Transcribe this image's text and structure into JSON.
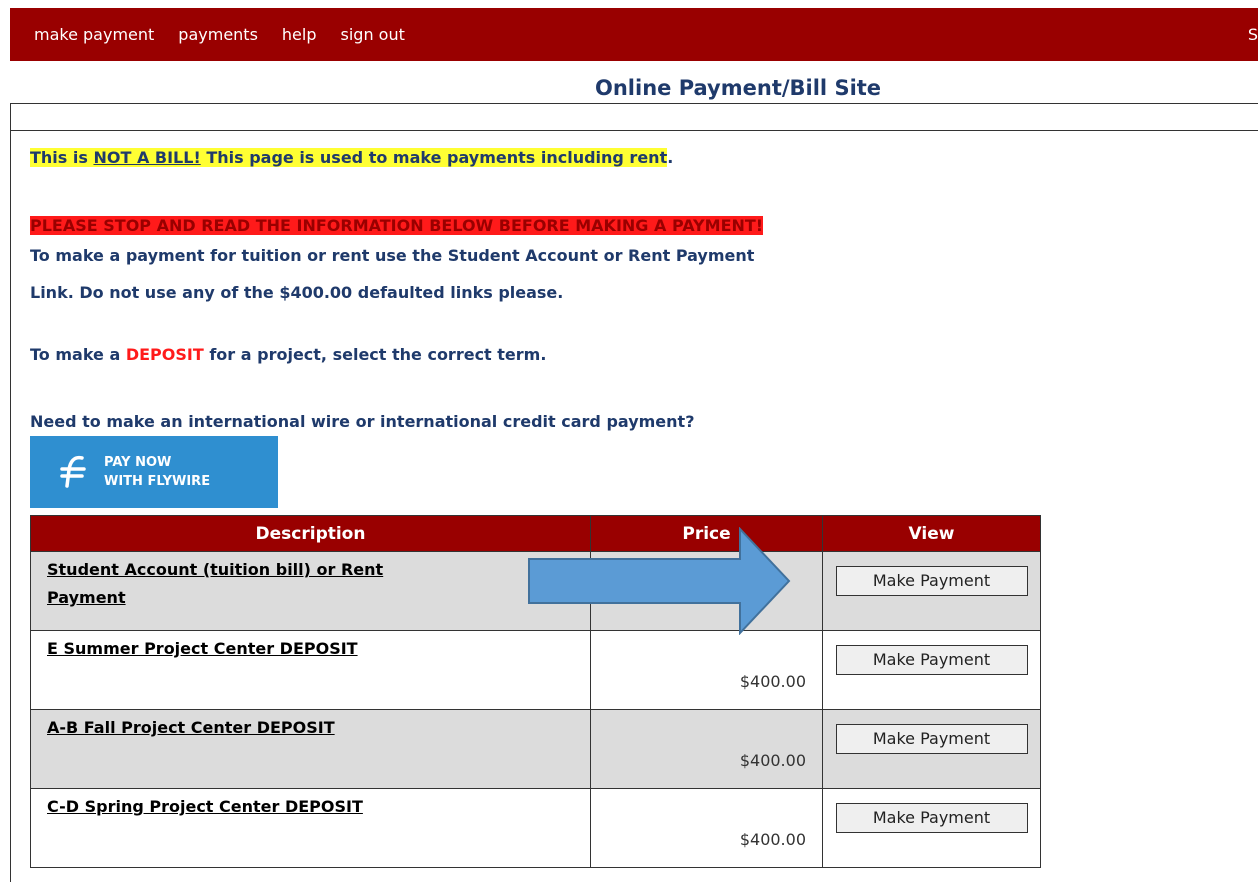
{
  "nav": {
    "items": [
      "make payment",
      "payments",
      "help",
      "sign out"
    ],
    "right_fragment": "S"
  },
  "site_title": "Online Payment/Bill Site",
  "notice": {
    "prefix": "This is",
    "not_a_bill": "NOT A BILL!",
    "suffix": "This page is used to make payments including rent",
    "period": "."
  },
  "warning": "PLEASE STOP AND READ THE INFORMATION BELOW BEFORE MAKING A PAYMENT!",
  "instructions": {
    "line1": "To make a payment for tuition or rent use the Student Account or Rent Payment",
    "line2": "Link.  Do not use any of the $400.00 defaulted links please.",
    "deposit_prefix": "To make a",
    "deposit_word": "DEPOSIT",
    "deposit_suffix": "for a project, select the correct term.",
    "international": "Need to make an international wire or international credit card payment?"
  },
  "flywire": {
    "line1": "PAY NOW",
    "line2": "WITH FLYWIRE",
    "icon": "flywire-logo-icon"
  },
  "table": {
    "headers": [
      "Description",
      "Price",
      "View"
    ],
    "rows": [
      {
        "desc_line1": "Student Account (tuition bill) or Rent",
        "desc_line2": "Payment",
        "price": "",
        "button": "Make Payment"
      },
      {
        "desc_line1": "E Summer Project Center DEPOSIT",
        "desc_line2": "",
        "price": "$400.00",
        "button": "Make Payment"
      },
      {
        "desc_line1": "A-B Fall Project Center DEPOSIT",
        "desc_line2": "",
        "price": "$400.00",
        "button": "Make Payment"
      },
      {
        "desc_line1": "C-D Spring Project Center DEPOSIT",
        "desc_line2": "",
        "price": "$400.00",
        "button": "Make Payment"
      }
    ]
  },
  "colors": {
    "nav_bg": "#990000",
    "title_text": "#1f3a6b",
    "highlight_yellow": "#ffff33",
    "warning_bg": "#ff1a1a",
    "flywire_bg": "#2f8fd0",
    "arrow_fill": "#5b9bd5",
    "row_gray": "#dcdcdc"
  }
}
